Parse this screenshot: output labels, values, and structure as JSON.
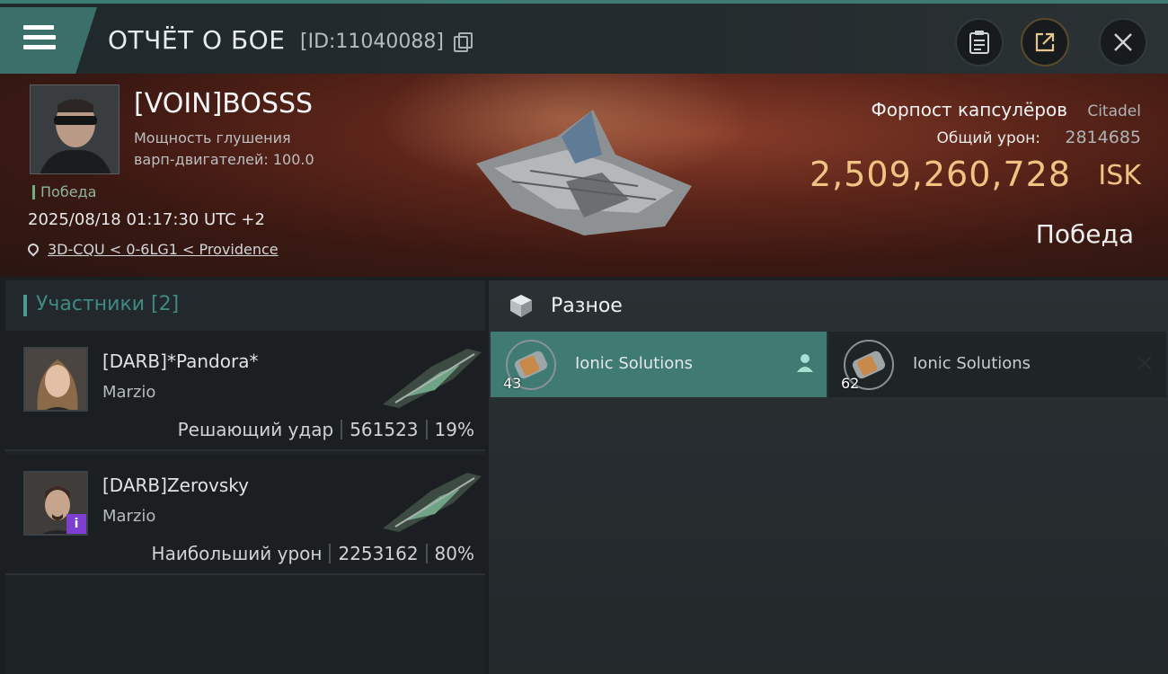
{
  "header": {
    "title": "ОТЧЁТ О БОЕ",
    "report_id": "[ID:11040088]",
    "icons": {
      "menu": "hamburger-menu-icon",
      "copy": "copy-icon",
      "clipboard": "clipboard-icon",
      "share": "share-icon",
      "close": "close-icon"
    }
  },
  "hero": {
    "pilot_name": "[VOIN]BOSSS",
    "stat_line1": "Мощность глушения",
    "stat_line2": "варп-двигателей: 100.0",
    "result_badge": "Победа",
    "datetime": "2025/08/18 01:17:30 UTC +2",
    "location": "3D-CQU < 0-6LG1 < Providence",
    "target_name": "Форпост капсулёров",
    "target_class": "Citadel",
    "damage_label": "Общий урон:",
    "damage_value": "2814685",
    "isk_value": "2,509,260,728",
    "isk_unit": "ISK",
    "result": "Победа"
  },
  "participants": {
    "header": "Участники [2]",
    "items": [
      {
        "name": "[DARB]*Pandora*",
        "corp": "Marzio",
        "role": "Решающий удар",
        "damage": "561523",
        "percent": "19%"
      },
      {
        "name": "[DARB]Zerovsky",
        "corp": "Marzio",
        "role": "Наибольший урон",
        "damage": "2253162",
        "percent": "80%"
      }
    ]
  },
  "misc": {
    "title": "Разное",
    "items": [
      {
        "name": "Ionic Solutions",
        "count": "43",
        "status_icon": "person-icon"
      },
      {
        "name": "Ionic Solutions",
        "count": "62",
        "status_icon": "x-icon"
      }
    ]
  },
  "colors": {
    "accent": "#3f7a73",
    "isk": "#f0c383",
    "victory": "#6fae7f",
    "badge": "#7d3fd1"
  }
}
